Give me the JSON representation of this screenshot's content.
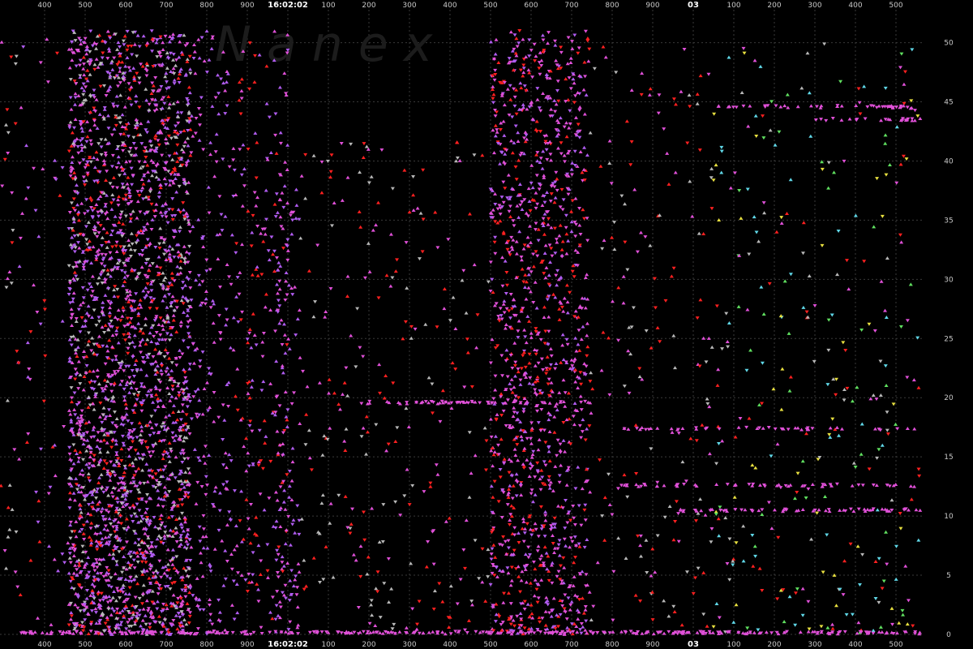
{
  "chart_data": {
    "type": "scatter",
    "watermark": "N a n e x",
    "x_axis": {
      "tick_labels": [
        "400",
        "500",
        "600",
        "700",
        "800",
        "900",
        "16:02:02",
        "100",
        "200",
        "300",
        "400",
        "500",
        "600",
        "700",
        "800",
        "900",
        "03",
        "100",
        "200",
        "300",
        "400",
        "500"
      ],
      "bold_labels": [
        "16:02:02",
        "03"
      ]
    },
    "y_axis": {
      "ylim": [
        0,
        51
      ],
      "ticks": [
        0,
        5,
        10,
        15,
        20,
        25,
        30,
        35,
        40,
        45,
        50
      ]
    },
    "grid": true,
    "colors": {
      "background": "#000000",
      "grid": "#3a3a3a",
      "purple": "#b05cf0",
      "pink": "#e050d8",
      "red": "#ff2020",
      "gray": "#b8b8b8",
      "yellow": "#e8e040",
      "cyan": "#60d8e8",
      "green": "#60e060"
    },
    "clusters": [
      {
        "name": "a",
        "x": [
          0,
          24
        ],
        "y": [
          0,
          51
        ],
        "n": 35,
        "colors": [
          "gray",
          "pink",
          "red"
        ]
      },
      {
        "name": "b",
        "x": [
          24,
          85
        ],
        "y": [
          0,
          51
        ],
        "n": 60,
        "colors": [
          "pink",
          "purple",
          "red"
        ]
      },
      {
        "name": "c",
        "x": [
          85,
          235
        ],
        "y": [
          0,
          51
        ],
        "n": 2600,
        "colors": [
          "purple",
          "purple",
          "pink",
          "pink",
          "red",
          "gray"
        ]
      },
      {
        "name": "d",
        "x": [
          235,
          290
        ],
        "y": [
          0,
          51
        ],
        "n": 220,
        "colors": [
          "purple",
          "pink"
        ]
      },
      {
        "name": "e",
        "x": [
          290,
          355
        ],
        "y": [
          0,
          51
        ],
        "n": 220,
        "colors": [
          "purple",
          "pink",
          "red"
        ]
      },
      {
        "name": "f",
        "x": [
          340,
          370
        ],
        "y": [
          0,
          38
        ],
        "n": 120,
        "colors": [
          "purple",
          "pink"
        ]
      },
      {
        "name": "g",
        "x": [
          370,
          605
        ],
        "y": [
          0,
          42
        ],
        "n": 260,
        "colors": [
          "pink",
          "gray",
          "red"
        ]
      },
      {
        "name": "h",
        "x": [
          605,
          725
        ],
        "y": [
          0,
          51
        ],
        "n": 1200,
        "colors": [
          "pink",
          "pink",
          "purple",
          "red"
        ]
      },
      {
        "name": "i",
        "x": [
          725,
          880
        ],
        "y": [
          0,
          50
        ],
        "n": 180,
        "colors": [
          "pink",
          "gray",
          "red"
        ]
      },
      {
        "name": "j",
        "x": [
          880,
          1135
        ],
        "y": [
          0,
          50
        ],
        "n": 300,
        "colors": [
          "pink",
          "gray",
          "red",
          "yellow",
          "cyan",
          "green"
        ]
      }
    ],
    "bands": [
      {
        "name": "band-45",
        "y": 44.6,
        "x": [
          880,
          1135
        ],
        "n": 45,
        "color": "pink"
      },
      {
        "name": "band-44",
        "y": 43.5,
        "x": [
          1000,
          1135
        ],
        "n": 25,
        "color": "pink"
      },
      {
        "name": "band-10",
        "y": 10.5,
        "x": [
          830,
          1135
        ],
        "n": 60,
        "color": "pink"
      },
      {
        "name": "band-12",
        "y": 12.6,
        "x": [
          760,
          1135
        ],
        "n": 55,
        "color": "pink"
      },
      {
        "name": "band-17",
        "y": 17.4,
        "x": [
          760,
          1135
        ],
        "n": 45,
        "color": "pink"
      },
      {
        "name": "band-20",
        "y": 19.6,
        "x": [
          440,
          745
        ],
        "n": 60,
        "color": "pink"
      },
      {
        "name": "band-0",
        "y": 0.15,
        "x": [
          20,
          1135
        ],
        "n": 300,
        "color": "pink"
      }
    ]
  }
}
